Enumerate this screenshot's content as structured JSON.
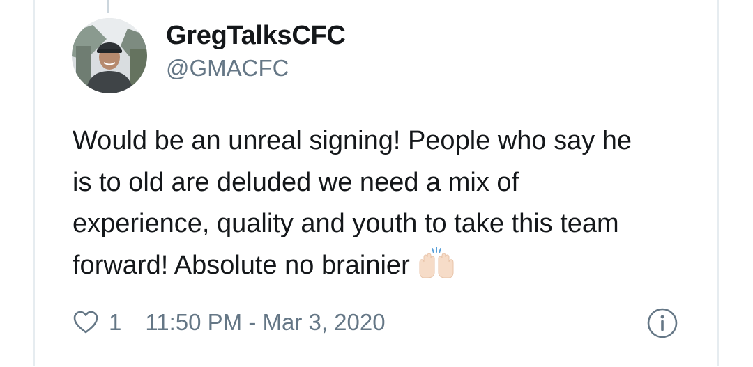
{
  "tweet": {
    "author_name": "GregTalksCFC",
    "author_handle": "@GMACFC",
    "text_lines": [
      "Would be an unreal signing! People who say he",
      "is to old are deluded we need a mix of",
      "experience, quality and youth to take this team",
      "forward! Absolute no brainier"
    ],
    "emoji": "raising-hands-emoji",
    "likes": "1",
    "timestamp": "11:50 PM - Mar 3, 2020"
  },
  "icons": {
    "like": "heart-icon",
    "info": "info-icon"
  },
  "colors": {
    "text_primary": "#14171a",
    "text_secondary": "#657786",
    "border": "#e6ecf0",
    "thread_line": "#ccd6dd"
  }
}
